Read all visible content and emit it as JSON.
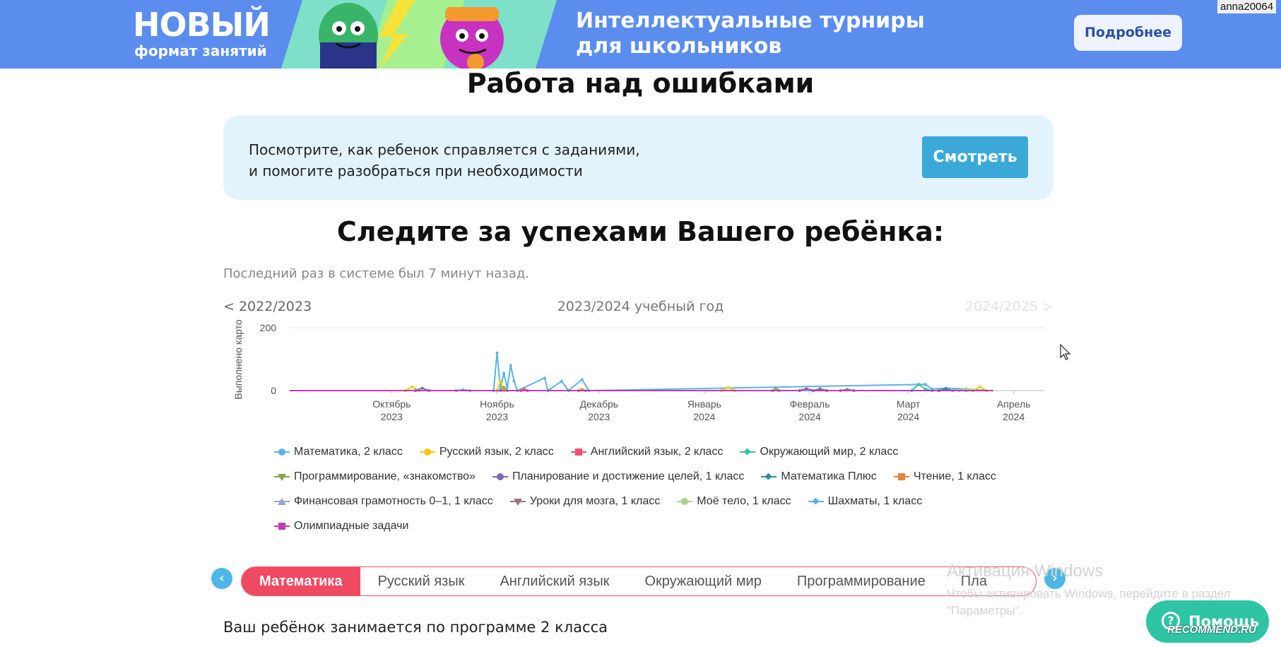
{
  "banner": {
    "promo_line1": "НОВЫЙ",
    "promo_line2": "формат занятий",
    "title_line1": "Интеллектуальные турниры",
    "title_line2": "для школьников",
    "button_label": "Подробнее",
    "color": "#5b8def"
  },
  "user_tag": "anna20064",
  "page": {
    "title": "Работа над ошибками",
    "review_text": "Посмотрите, как ребенок справляется с заданиями,\nи помогите разобраться при необходимости",
    "review_button": "Смотреть",
    "follow_title": "Следите за успехами Вашего ребёнка:",
    "last_seen": "Последний раз в системе был 7 минут назад.",
    "year_prev": "< 2022/2023",
    "year_current": "2023/2024 учебный год",
    "year_next": "2024/2025 >"
  },
  "chart_data": {
    "type": "line",
    "ylabel": "Выполнено карто",
    "ylim": [
      0,
      200
    ],
    "yticks": [
      "200",
      "0"
    ],
    "grid": true,
    "legend_position": "bottom",
    "x_ticks": [
      {
        "month": "Октябрь",
        "year": "2023"
      },
      {
        "month": "Ноябрь",
        "year": "2023"
      },
      {
        "month": "Декабрь",
        "year": "2023"
      },
      {
        "month": "Январь",
        "year": "2024"
      },
      {
        "month": "Февраль",
        "year": "2024"
      },
      {
        "month": "Март",
        "year": "2024"
      },
      {
        "month": "Апрель",
        "year": "2024"
      }
    ],
    "series": [
      {
        "name": "Математика, 2 класс",
        "color": "#5ab4e3",
        "marker": "circle",
        "points": [
          [
            "2023-10-31",
            0
          ],
          [
            "2023-11-01",
            120
          ],
          [
            "2023-11-02",
            5
          ],
          [
            "2023-11-03",
            55
          ],
          [
            "2023-11-04",
            10
          ],
          [
            "2023-11-05",
            80
          ],
          [
            "2023-11-06",
            30
          ],
          [
            "2023-11-07",
            0
          ],
          [
            "2023-11-15",
            40
          ],
          [
            "2023-11-16",
            0
          ],
          [
            "2023-11-20",
            30
          ],
          [
            "2023-11-22",
            0
          ],
          [
            "2023-11-26",
            35
          ],
          [
            "2023-11-28",
            0
          ],
          [
            "2024-03-06",
            20
          ],
          [
            "2024-03-08",
            5
          ],
          [
            "2024-03-12",
            8
          ],
          [
            "2024-03-18",
            5
          ],
          [
            "2024-03-24",
            0
          ]
        ]
      },
      {
        "name": "Русский язык, 2 класс",
        "color": "#f2c811",
        "marker": "circle",
        "points": [
          [
            "2023-10-05",
            0
          ],
          [
            "2023-10-07",
            12
          ],
          [
            "2023-10-09",
            0
          ],
          [
            "2023-11-01",
            0
          ],
          [
            "2023-11-02",
            30
          ],
          [
            "2023-11-03",
            0
          ],
          [
            "2024-01-06",
            0
          ],
          [
            "2024-01-08",
            10
          ],
          [
            "2024-01-10",
            0
          ],
          [
            "2024-03-20",
            0
          ],
          [
            "2024-03-22",
            12
          ],
          [
            "2024-03-24",
            0
          ]
        ]
      },
      {
        "name": "Английский язык, 2 класс",
        "color": "#f0506e",
        "marker": "square",
        "points": [
          [
            "2023-11-08",
            0
          ],
          [
            "2023-11-09",
            5
          ],
          [
            "2023-11-10",
            0
          ]
        ]
      },
      {
        "name": "Окружающий мир, 2 класс",
        "color": "#2ec4a4",
        "marker": "diamond",
        "points": [
          [
            "2024-03-02",
            0
          ],
          [
            "2024-03-04",
            20
          ],
          [
            "2024-03-06",
            5
          ],
          [
            "2024-03-08",
            0
          ]
        ]
      },
      {
        "name": "Программирование, «знакомство»",
        "color": "#8aa04a",
        "marker": "triangle-down",
        "points": [
          [
            "2023-11-02",
            0
          ],
          [
            "2023-11-03",
            10
          ],
          [
            "2023-11-04",
            0
          ],
          [
            "2024-01-21",
            0
          ],
          [
            "2024-01-22",
            8
          ],
          [
            "2024-01-23",
            0
          ]
        ]
      },
      {
        "name": "Планирование и достижение целей, 1 класс",
        "color": "#7a68b0",
        "marker": "circle",
        "points": [
          [
            "2023-10-08",
            0
          ],
          [
            "2023-10-10",
            8
          ],
          [
            "2023-10-12",
            0
          ],
          [
            "2024-02-02",
            0
          ],
          [
            "2024-02-04",
            6
          ],
          [
            "2024-02-06",
            0
          ]
        ]
      },
      {
        "name": "Математика Плюс",
        "color": "#2f8ba0",
        "marker": "diamond",
        "points": [
          [
            "2024-03-10",
            0
          ],
          [
            "2024-03-12",
            6
          ],
          [
            "2024-03-14",
            0
          ]
        ]
      },
      {
        "name": "Чтение, 1 класс",
        "color": "#e8833a",
        "marker": "square",
        "points": [
          [
            "2023-11-25",
            0
          ],
          [
            "2023-11-26",
            4
          ],
          [
            "2023-11-27",
            0
          ]
        ]
      },
      {
        "name": "Финансовая грамотность 0–1, 1 класс",
        "color": "#8fa7d6",
        "marker": "triangle-up",
        "points": [
          [
            "2024-03-14",
            0
          ],
          [
            "2024-03-16",
            5
          ],
          [
            "2024-03-18",
            0
          ]
        ]
      },
      {
        "name": "Уроки для мозга, 1 класс",
        "color": "#a0707a",
        "marker": "triangle-down",
        "points": [
          [
            "2024-02-10",
            0
          ],
          [
            "2024-02-12",
            4
          ],
          [
            "2024-02-14",
            0
          ]
        ]
      },
      {
        "name": "Моё тело, 1 класс",
        "color": "#a9d18e",
        "marker": "circle",
        "points": [
          [
            "2024-03-16",
            0
          ],
          [
            "2024-03-18",
            6
          ],
          [
            "2024-03-20",
            0
          ]
        ]
      },
      {
        "name": "Шахматы, 1 класс",
        "color": "#5fb0e0",
        "marker": "diamond",
        "points": [
          [
            "2023-10-20",
            0
          ],
          [
            "2023-10-22",
            3
          ],
          [
            "2023-10-24",
            0
          ]
        ]
      },
      {
        "name": "Олимпиадные задачи",
        "color": "#c03cb0",
        "marker": "square",
        "points": [
          [
            "2024-01-29",
            0
          ],
          [
            "2024-01-31",
            6
          ],
          [
            "2024-02-02",
            0
          ]
        ]
      }
    ]
  },
  "tabs": {
    "items": [
      "Математика",
      "Русский язык",
      "Английский язык",
      "Окружающий мир",
      "Программирование",
      "Пла"
    ],
    "active": 0
  },
  "program_text": "Ваш ребёнок занимается по программе 2 класса",
  "windows_activation": {
    "line1": "Активация Windows",
    "line2": "Чтобы активировать Windows, перейдите в раздел",
    "line3": "\"Параметры\"."
  },
  "help_button": "Помощь",
  "watermark": "RECOMMEND.RU"
}
